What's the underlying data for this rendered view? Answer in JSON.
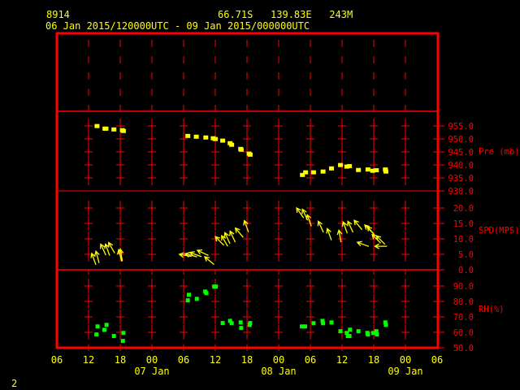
{
  "header": {
    "station": "8914",
    "location": "66.71S   139.83E   243M",
    "period": "06 Jan 2015/120000UTC - 09 Jan 2015/000000UTC"
  },
  "corner_label": "2",
  "colors": {
    "frame": "#ff0000",
    "pressure": "#ffff00",
    "wind": "#ffff00",
    "rh": "#00ff00",
    "text": "#ffff00",
    "axis_text": "#ff0000"
  },
  "chart_data": {
    "type": "scatter",
    "x_range": [
      "2015-01-06 06:00",
      "2015-01-09 06:00"
    ],
    "x_tick_labels": [
      "06",
      "12",
      "18",
      "00",
      "06",
      "12",
      "18",
      "00",
      "06",
      "12",
      "18",
      "00",
      "06"
    ],
    "x_day_labels": [
      {
        "label": "07 Jan",
        "at": "2015-01-07 00:00"
      },
      {
        "label": "08 Jan",
        "at": "2015-01-08 00:00"
      },
      {
        "label": "09 Jan",
        "at": "2015-01-09 00:00"
      }
    ],
    "panels": [
      {
        "name": "Pre (mb)",
        "ylim": [
          930,
          955
        ],
        "y_tick_labels": [
          "955.0",
          "950.0",
          "945.0",
          "940.0",
          "935.0",
          "930.0"
        ],
        "y_ticks": [
          955,
          950,
          945,
          940,
          935,
          930
        ],
        "points": [
          [
            "2015-01-06 13:36",
            954.8
          ],
          [
            "2015-01-06 15:06",
            953.8
          ],
          [
            "2015-01-06 15:18",
            953.8
          ],
          [
            "2015-01-06 16:48",
            953.5
          ],
          [
            "2015-01-06 18:24",
            953.2
          ],
          [
            "2015-01-06 18:36",
            952.9
          ],
          [
            "2015-01-07 06:48",
            951.0
          ],
          [
            "2015-01-07 08:24",
            950.7
          ],
          [
            "2015-01-07 10:12",
            950.4
          ],
          [
            "2015-01-07 11:36",
            950.1
          ],
          [
            "2015-01-07 12:00",
            949.8
          ],
          [
            "2015-01-07 13:24",
            949.2
          ],
          [
            "2015-01-07 14:48",
            948.2
          ],
          [
            "2015-01-07 15:06",
            947.6
          ],
          [
            "2015-01-07 16:48",
            946.0
          ],
          [
            "2015-01-07 16:54",
            945.7
          ],
          [
            "2015-01-07 18:24",
            944.2
          ],
          [
            "2015-01-07 18:36",
            943.8
          ],
          [
            "2015-01-08 04:30",
            936.0
          ],
          [
            "2015-01-08 05:06",
            937.0
          ],
          [
            "2015-01-08 06:36",
            937.0
          ],
          [
            "2015-01-08 08:24",
            937.3
          ],
          [
            "2015-01-08 10:00",
            938.5
          ],
          [
            "2015-01-08 11:42",
            939.8
          ],
          [
            "2015-01-08 12:54",
            939.2
          ],
          [
            "2015-01-08 13:24",
            939.4
          ],
          [
            "2015-01-08 15:06",
            937.9
          ],
          [
            "2015-01-08 16:54",
            938.1
          ],
          [
            "2015-01-08 17:48",
            937.6
          ],
          [
            "2015-01-08 18:30",
            937.8
          ],
          [
            "2015-01-08 20:12",
            938.1
          ],
          [
            "2015-01-08 20:18",
            937.3
          ]
        ]
      },
      {
        "name": "SPD(MPS)",
        "ylim": [
          0,
          20
        ],
        "y_tick_labels": [
          "20.0",
          "15.0",
          "10.0",
          "5.0",
          "0.0"
        ],
        "y_ticks": [
          20,
          15,
          10,
          5,
          0
        ],
        "arrows_note_fields": [
          "time",
          "speed",
          "arrow_bearing_deg"
        ],
        "points": [
          [
            "2015-01-06 12:36",
            5.3,
            340
          ],
          [
            "2015-01-06 13:24",
            6.0,
            345
          ],
          [
            "2015-01-06 14:18",
            8.3,
            335
          ],
          [
            "2015-01-06 15:12",
            8.3,
            340
          ],
          [
            "2015-01-06 15:48",
            8.8,
            330
          ],
          [
            "2015-01-06 17:42",
            6.5,
            345
          ],
          [
            "2015-01-06 18:00",
            6.7,
            350
          ],
          [
            "2015-01-07 05:12",
            5.0,
            280
          ],
          [
            "2015-01-07 06:18",
            5.2,
            285
          ],
          [
            "2015-01-07 07:12",
            5.6,
            290
          ],
          [
            "2015-01-07 08:36",
            6.3,
            295
          ],
          [
            "2015-01-07 10:00",
            4.2,
            310
          ],
          [
            "2015-01-07 12:00",
            10.7,
            315
          ],
          [
            "2015-01-07 13:12",
            11.0,
            330
          ],
          [
            "2015-01-07 13:48",
            12.0,
            335
          ],
          [
            "2015-01-07 14:48",
            12.5,
            335
          ],
          [
            "2015-01-07 15:48",
            13.5,
            320
          ],
          [
            "2015-01-07 17:30",
            15.9,
            340
          ],
          [
            "2015-01-08 03:24",
            20.0,
            325
          ],
          [
            "2015-01-08 04:30",
            19.6,
            335
          ],
          [
            "2015-01-08 05:24",
            17.8,
            340
          ],
          [
            "2015-01-08 07:30",
            15.7,
            335
          ],
          [
            "2015-01-08 09:12",
            13.3,
            340
          ],
          [
            "2015-01-08 11:24",
            12.8,
            350
          ],
          [
            "2015-01-08 12:12",
            15.5,
            340
          ],
          [
            "2015-01-08 13:06",
            15.7,
            335
          ],
          [
            "2015-01-08 14:18",
            16.0,
            320
          ],
          [
            "2015-01-08 14:54",
            8.9,
            290
          ],
          [
            "2015-01-08 16:18",
            14.5,
            315
          ],
          [
            "2015-01-08 16:48",
            14.0,
            320
          ],
          [
            "2015-01-08 17:42",
            11.4,
            315
          ],
          [
            "2015-01-08 18:12",
            7.6,
            270
          ],
          [
            "2015-01-08 18:30",
            11.0,
            315
          ]
        ]
      },
      {
        "name": "RH(%)",
        "ylim": [
          50,
          90
        ],
        "y_tick_labels": [
          "90.0",
          "80.0",
          "70.0",
          "60.0",
          "50.0"
        ],
        "y_ticks": [
          90,
          80,
          70,
          60,
          50
        ],
        "points": [
          [
            "2015-01-06 13:30",
            58.6
          ],
          [
            "2015-01-06 13:42",
            63.8
          ],
          [
            "2015-01-06 15:00",
            61.6
          ],
          [
            "2015-01-06 15:24",
            64.8
          ],
          [
            "2015-01-06 16:48",
            57.6
          ],
          [
            "2015-01-06 18:30",
            54.4
          ],
          [
            "2015-01-06 18:36",
            59.6
          ],
          [
            "2015-01-07 06:48",
            80.7
          ],
          [
            "2015-01-07 07:00",
            84.3
          ],
          [
            "2015-01-07 08:30",
            81.7
          ],
          [
            "2015-01-07 10:06",
            86.4
          ],
          [
            "2015-01-07 10:18",
            85.4
          ],
          [
            "2015-01-07 11:48",
            89.6
          ],
          [
            "2015-01-07 12:06",
            89.6
          ],
          [
            "2015-01-07 13:24",
            66.0
          ],
          [
            "2015-01-07 14:48",
            67.4
          ],
          [
            "2015-01-07 15:06",
            65.9
          ],
          [
            "2015-01-07 16:48",
            66.4
          ],
          [
            "2015-01-07 16:54",
            62.8
          ],
          [
            "2015-01-07 18:30",
            64.8
          ],
          [
            "2015-01-07 18:36",
            66.0
          ],
          [
            "2015-01-08 04:24",
            63.8
          ],
          [
            "2015-01-08 05:00",
            63.8
          ],
          [
            "2015-01-08 06:36",
            65.9
          ],
          [
            "2015-01-08 08:18",
            67.4
          ],
          [
            "2015-01-08 08:24",
            65.9
          ],
          [
            "2015-01-08 10:00",
            66.4
          ],
          [
            "2015-01-08 11:42",
            60.7
          ],
          [
            "2015-01-08 12:54",
            59.6
          ],
          [
            "2015-01-08 13:06",
            57.6
          ],
          [
            "2015-01-08 13:24",
            57.6
          ],
          [
            "2015-01-08 13:30",
            61.7
          ],
          [
            "2015-01-08 15:06",
            60.7
          ],
          [
            "2015-01-08 16:48",
            59.6
          ],
          [
            "2015-01-08 16:54",
            58.6
          ],
          [
            "2015-01-08 17:54",
            59.6
          ],
          [
            "2015-01-08 18:30",
            60.7
          ],
          [
            "2015-01-08 18:36",
            58.6
          ],
          [
            "2015-01-08 20:12",
            66.4
          ],
          [
            "2015-01-08 20:18",
            64.8
          ]
        ]
      }
    ]
  }
}
